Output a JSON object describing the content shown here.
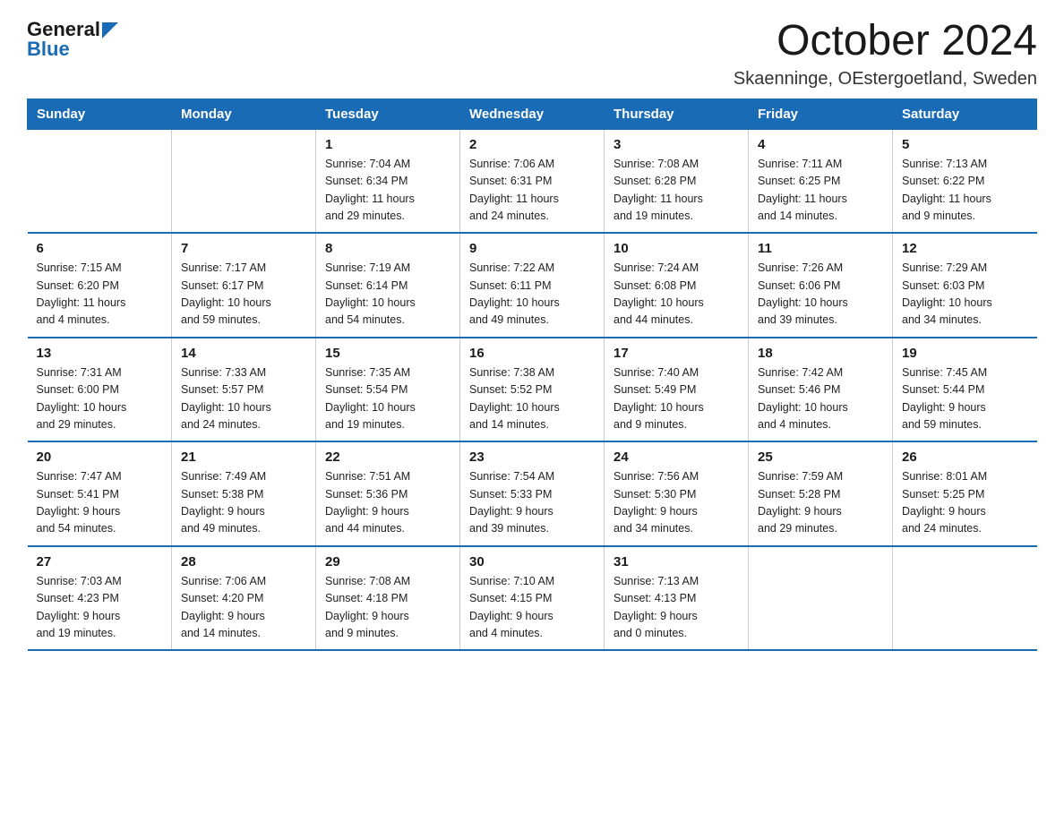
{
  "logo": {
    "general": "General",
    "blue": "Blue"
  },
  "title": "October 2024",
  "subtitle": "Skaenninge, OEstergoetland, Sweden",
  "headers": [
    "Sunday",
    "Monday",
    "Tuesday",
    "Wednesday",
    "Thursday",
    "Friday",
    "Saturday"
  ],
  "weeks": [
    [
      {
        "num": "",
        "info": ""
      },
      {
        "num": "",
        "info": ""
      },
      {
        "num": "1",
        "info": "Sunrise: 7:04 AM\nSunset: 6:34 PM\nDaylight: 11 hours\nand 29 minutes."
      },
      {
        "num": "2",
        "info": "Sunrise: 7:06 AM\nSunset: 6:31 PM\nDaylight: 11 hours\nand 24 minutes."
      },
      {
        "num": "3",
        "info": "Sunrise: 7:08 AM\nSunset: 6:28 PM\nDaylight: 11 hours\nand 19 minutes."
      },
      {
        "num": "4",
        "info": "Sunrise: 7:11 AM\nSunset: 6:25 PM\nDaylight: 11 hours\nand 14 minutes."
      },
      {
        "num": "5",
        "info": "Sunrise: 7:13 AM\nSunset: 6:22 PM\nDaylight: 11 hours\nand 9 minutes."
      }
    ],
    [
      {
        "num": "6",
        "info": "Sunrise: 7:15 AM\nSunset: 6:20 PM\nDaylight: 11 hours\nand 4 minutes."
      },
      {
        "num": "7",
        "info": "Sunrise: 7:17 AM\nSunset: 6:17 PM\nDaylight: 10 hours\nand 59 minutes."
      },
      {
        "num": "8",
        "info": "Sunrise: 7:19 AM\nSunset: 6:14 PM\nDaylight: 10 hours\nand 54 minutes."
      },
      {
        "num": "9",
        "info": "Sunrise: 7:22 AM\nSunset: 6:11 PM\nDaylight: 10 hours\nand 49 minutes."
      },
      {
        "num": "10",
        "info": "Sunrise: 7:24 AM\nSunset: 6:08 PM\nDaylight: 10 hours\nand 44 minutes."
      },
      {
        "num": "11",
        "info": "Sunrise: 7:26 AM\nSunset: 6:06 PM\nDaylight: 10 hours\nand 39 minutes."
      },
      {
        "num": "12",
        "info": "Sunrise: 7:29 AM\nSunset: 6:03 PM\nDaylight: 10 hours\nand 34 minutes."
      }
    ],
    [
      {
        "num": "13",
        "info": "Sunrise: 7:31 AM\nSunset: 6:00 PM\nDaylight: 10 hours\nand 29 minutes."
      },
      {
        "num": "14",
        "info": "Sunrise: 7:33 AM\nSunset: 5:57 PM\nDaylight: 10 hours\nand 24 minutes."
      },
      {
        "num": "15",
        "info": "Sunrise: 7:35 AM\nSunset: 5:54 PM\nDaylight: 10 hours\nand 19 minutes."
      },
      {
        "num": "16",
        "info": "Sunrise: 7:38 AM\nSunset: 5:52 PM\nDaylight: 10 hours\nand 14 minutes."
      },
      {
        "num": "17",
        "info": "Sunrise: 7:40 AM\nSunset: 5:49 PM\nDaylight: 10 hours\nand 9 minutes."
      },
      {
        "num": "18",
        "info": "Sunrise: 7:42 AM\nSunset: 5:46 PM\nDaylight: 10 hours\nand 4 minutes."
      },
      {
        "num": "19",
        "info": "Sunrise: 7:45 AM\nSunset: 5:44 PM\nDaylight: 9 hours\nand 59 minutes."
      }
    ],
    [
      {
        "num": "20",
        "info": "Sunrise: 7:47 AM\nSunset: 5:41 PM\nDaylight: 9 hours\nand 54 minutes."
      },
      {
        "num": "21",
        "info": "Sunrise: 7:49 AM\nSunset: 5:38 PM\nDaylight: 9 hours\nand 49 minutes."
      },
      {
        "num": "22",
        "info": "Sunrise: 7:51 AM\nSunset: 5:36 PM\nDaylight: 9 hours\nand 44 minutes."
      },
      {
        "num": "23",
        "info": "Sunrise: 7:54 AM\nSunset: 5:33 PM\nDaylight: 9 hours\nand 39 minutes."
      },
      {
        "num": "24",
        "info": "Sunrise: 7:56 AM\nSunset: 5:30 PM\nDaylight: 9 hours\nand 34 minutes."
      },
      {
        "num": "25",
        "info": "Sunrise: 7:59 AM\nSunset: 5:28 PM\nDaylight: 9 hours\nand 29 minutes."
      },
      {
        "num": "26",
        "info": "Sunrise: 8:01 AM\nSunset: 5:25 PM\nDaylight: 9 hours\nand 24 minutes."
      }
    ],
    [
      {
        "num": "27",
        "info": "Sunrise: 7:03 AM\nSunset: 4:23 PM\nDaylight: 9 hours\nand 19 minutes."
      },
      {
        "num": "28",
        "info": "Sunrise: 7:06 AM\nSunset: 4:20 PM\nDaylight: 9 hours\nand 14 minutes."
      },
      {
        "num": "29",
        "info": "Sunrise: 7:08 AM\nSunset: 4:18 PM\nDaylight: 9 hours\nand 9 minutes."
      },
      {
        "num": "30",
        "info": "Sunrise: 7:10 AM\nSunset: 4:15 PM\nDaylight: 9 hours\nand 4 minutes."
      },
      {
        "num": "31",
        "info": "Sunrise: 7:13 AM\nSunset: 4:13 PM\nDaylight: 9 hours\nand 0 minutes."
      },
      {
        "num": "",
        "info": ""
      },
      {
        "num": "",
        "info": ""
      }
    ]
  ]
}
